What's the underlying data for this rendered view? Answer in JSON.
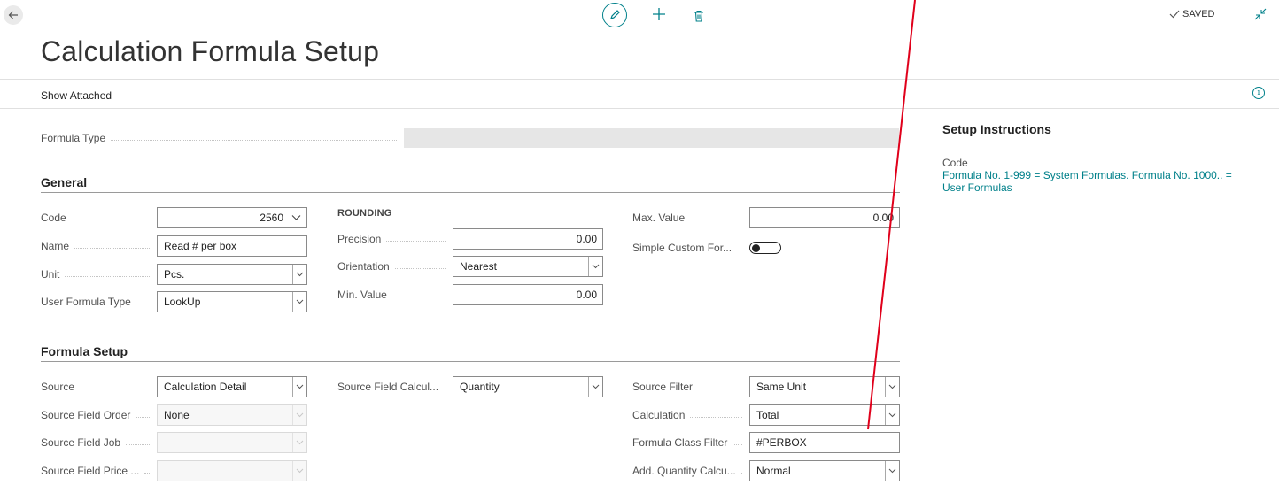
{
  "topbar": {
    "back_icon": "arrow-left-icon",
    "edit_icon": "pencil-icon",
    "new_icon": "plus-icon",
    "delete_icon": "trash-icon",
    "saved_label": "SAVED",
    "collapse_icon": "collapse-icon"
  },
  "page": {
    "title": "Calculation Formula Setup"
  },
  "actionbar": {
    "show_attached": "Show Attached",
    "info_icon": "info-icon"
  },
  "header_fields": {
    "formula_type": {
      "label": "Formula Type",
      "value": ""
    }
  },
  "general": {
    "title": "General",
    "code": {
      "label": "Code",
      "value": "2560"
    },
    "name": {
      "label": "Name",
      "value": "Read # per box"
    },
    "unit": {
      "label": "Unit",
      "value": "Pcs."
    },
    "user_formula_type": {
      "label": "User Formula Type",
      "value": "LookUp"
    },
    "rounding_caption": "ROUNDING",
    "precision": {
      "label": "Precision",
      "value": "0.00"
    },
    "orientation": {
      "label": "Orientation",
      "value": "Nearest"
    },
    "min_value": {
      "label": "Min. Value",
      "value": "0.00"
    },
    "max_value": {
      "label": "Max. Value",
      "value": "0.00"
    },
    "simple_custom_formula": {
      "label": "Simple Custom For...",
      "value": false
    }
  },
  "formula_setup": {
    "title": "Formula Setup",
    "source": {
      "label": "Source",
      "value": "Calculation Detail"
    },
    "source_field_order": {
      "label": "Source Field Order",
      "value": "None"
    },
    "source_field_job": {
      "label": "Source Field Job",
      "value": ""
    },
    "source_field_price": {
      "label": "Source Field Price ...",
      "value": ""
    },
    "source_field_calcul": {
      "label": "Source Field Calcul...",
      "value": "Quantity"
    },
    "source_filter": {
      "label": "Source Filter",
      "value": "Same Unit"
    },
    "calculation": {
      "label": "Calculation",
      "value": "Total"
    },
    "formula_class_filter": {
      "label": "Formula Class Filter",
      "value": "#PERBOX"
    },
    "add_quantity_calcu": {
      "label": "Add. Quantity Calcu...",
      "value": "Normal"
    }
  },
  "factbox": {
    "title": "Setup Instructions",
    "caption": "Code",
    "text": "Formula No. 1-999 = System Formulas. Formula No. 1000.. = User Formulas"
  },
  "colors": {
    "accent": "#00808a",
    "annotation_line": "#e0001b"
  }
}
